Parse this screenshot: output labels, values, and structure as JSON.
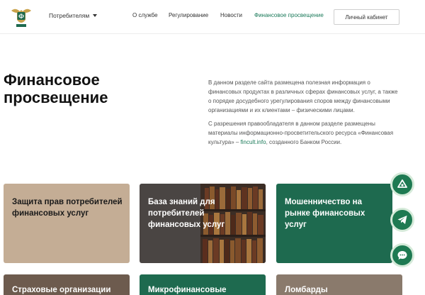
{
  "header": {
    "logo_icon": "eagle-shield-logo-icon",
    "consumers_menu": "Потребителям",
    "nav": [
      {
        "label": "О службе",
        "active": false
      },
      {
        "label": "Регулирование",
        "active": false
      },
      {
        "label": "Новости",
        "active": false
      },
      {
        "label": "Финансовое просвещение",
        "active": true
      }
    ],
    "cabinet_button": "Личный кабинет"
  },
  "hero": {
    "title_line1": "Финансовое",
    "title_line2": "просвещение",
    "paragraph1": "В данном разделе сайта размещена полезная информация о финансовых продуктах в различных сферах финансовых услуг, а также о порядке досудебного урегулирования споров между финансовыми организациями и их клиентами – физическими лицами.",
    "paragraph2_before": "С разрешения правообладателя в данном разделе размещены материалы информационно-просветительского ресурса «Финансовая культура» – ",
    "paragraph2_link": "fincult.info",
    "paragraph2_after": ", созданного Банком России."
  },
  "cards": [
    {
      "label": "Защита прав потребителей финансовых услуг"
    },
    {
      "label": "База знаний для потребителей финансовых услуг"
    },
    {
      "label": "Мошенничество на рынке финансовых услуг"
    },
    {
      "label": "Страховые организации"
    },
    {
      "label": "Микрофинансовые"
    },
    {
      "label": "Ломбарды"
    }
  ],
  "fabs": [
    {
      "icon": "logo-leaf-icon"
    },
    {
      "icon": "telegram-icon"
    },
    {
      "icon": "chat-icon"
    }
  ],
  "colors": {
    "brand_green": "#1e6a4f",
    "accent_link": "#1b7a5a",
    "card_beige": "#c4ad95"
  }
}
